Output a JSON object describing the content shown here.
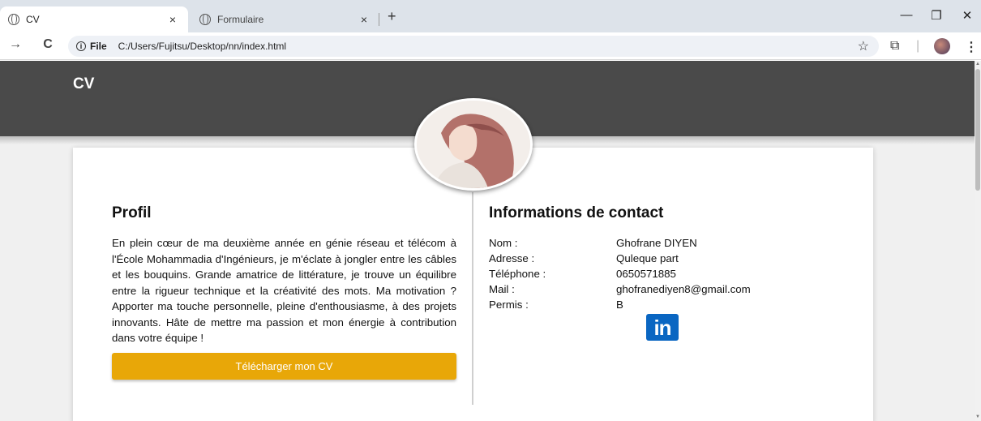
{
  "browser": {
    "tabs": [
      {
        "title": "CV",
        "active": true
      },
      {
        "title": "Formulaire",
        "active": false
      }
    ],
    "tab_close": "×",
    "new_tab": "+",
    "window_controls": {
      "minimize": "—",
      "restore": "❐",
      "close": "✕"
    },
    "nav": {
      "back": "→",
      "reload": "C"
    },
    "omnibox": {
      "info_icon": "i",
      "chip": "File",
      "url": "C:/Users/Fujitsu/Desktop/nn/index.html"
    },
    "bookmark_icon": "☆",
    "extensions_icon": "⧉",
    "menu_icon": "⋮",
    "divider": "|"
  },
  "page": {
    "brand": "CV",
    "profile": {
      "heading": "Profil",
      "text": "En plein cœur de ma deuxième année en génie réseau et télécom à l'École Mohammadia d'Ingénieurs, je m'éclate à jongler entre les câbles et les bouquins. Grande amatrice de littérature, je trouve un équilibre entre la rigueur technique et la créativité des mots. Ma motivation ? Apporter ma touche personnelle, pleine d'enthousiasme, à des projets innovants. Hâte de mettre ma passion et mon énergie à contribution dans votre équipe !",
      "download_button": "Télécharger mon CV"
    },
    "contact": {
      "heading": "Informations de contact",
      "rows": [
        {
          "label": "Nom :",
          "value": "Ghofrane DIYEN"
        },
        {
          "label": "Adresse :",
          "value": "Quleque part"
        },
        {
          "label": "Téléphone :",
          "value": "0650571885"
        },
        {
          "label": "Mail :",
          "value": "ghofranediyen8@gmail.com"
        },
        {
          "label": "Permis :",
          "value": "B"
        }
      ],
      "linkedin_text": "in"
    }
  },
  "colors": {
    "header_bg": "#4a4a4a",
    "button": "#e8a708",
    "linkedin": "#0a66c2"
  }
}
